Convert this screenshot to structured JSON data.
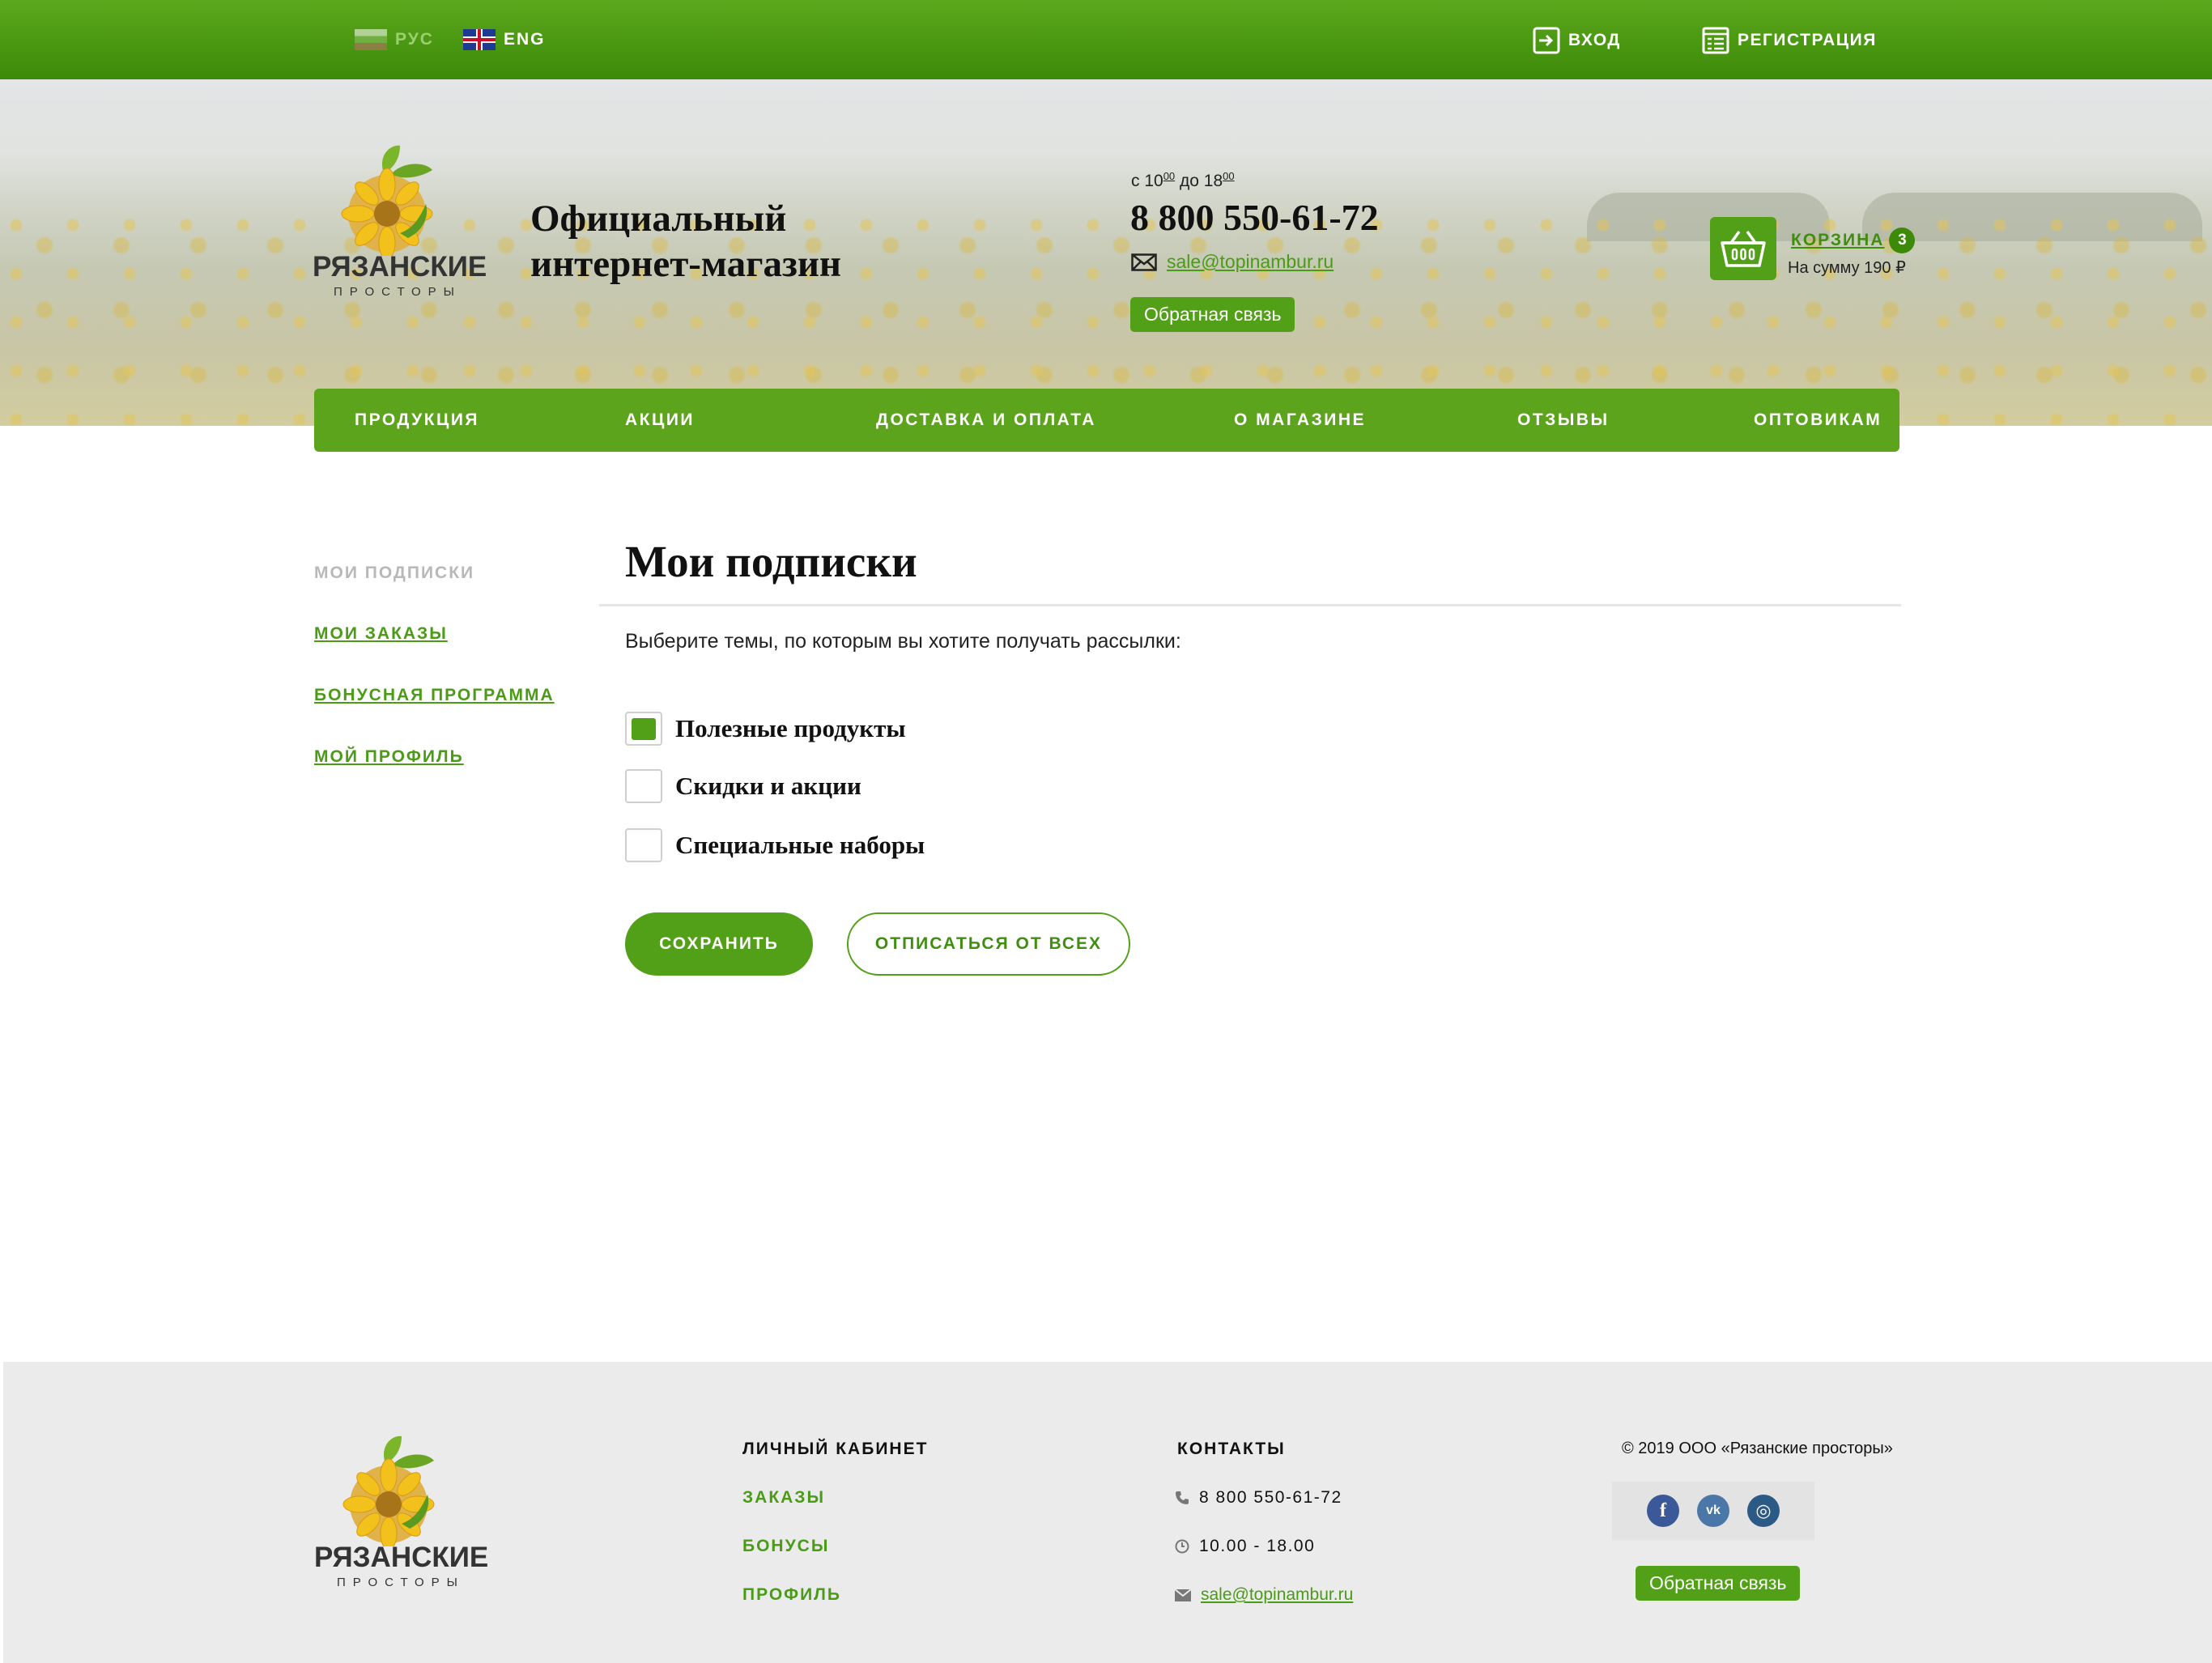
{
  "topbar": {
    "lang_ru": "РУС",
    "lang_en": "ENG",
    "login": "ВХОД",
    "register": "РЕГИСТРАЦИЯ"
  },
  "brand": {
    "name": "РЯЗАНСКИЕ",
    "sub": "ПРОСТОРЫ",
    "tagline_line1": "Официальный",
    "tagline_line2": "интернет-магазин"
  },
  "contacts": {
    "hours_from": "с 10",
    "hours_from_sup": "00",
    "hours_to": "до 18",
    "hours_to_sup": "00",
    "phone": "8 800 550-61-72",
    "email": "sale@topinambur.ru",
    "feedback": "Обратная связь"
  },
  "cart": {
    "label": "КОРЗИНА",
    "count": "3",
    "sum": "На сумму 190 ₽"
  },
  "nav": [
    "ПРОДУКЦИЯ",
    "АКЦИИ",
    "ДОСТАВКА И ОПЛАТА",
    "О МАГАЗИНЕ",
    "ОТЗЫВЫ",
    "ОПТОВИКАМ"
  ],
  "sidebar": {
    "items": [
      {
        "label": "МОИ ПОДПИСКИ",
        "active": true
      },
      {
        "label": "МОИ ЗАКАЗЫ",
        "active": false
      },
      {
        "label": "БОНУСНАЯ ПРОГРАММА",
        "active": false
      },
      {
        "label": "МОЙ ПРОФИЛЬ",
        "active": false
      }
    ]
  },
  "main": {
    "title": "Мои подписки",
    "intro": "Выберите темы, по которым вы хотите получать рассылки:",
    "options": [
      {
        "label": "Полезные продукты",
        "checked": true
      },
      {
        "label": "Скидки и акции",
        "checked": false
      },
      {
        "label": "Специальные наборы",
        "checked": false
      }
    ],
    "save": "СОХРАНИТЬ",
    "unsubscribe": "ОТПИСАТЬСЯ ОТ ВСЕХ"
  },
  "footer": {
    "cabinet_title": "ЛИЧНЫЙ КАБИНЕТ",
    "cabinet_links": [
      "ЗАКАЗЫ",
      "БОНУСЫ",
      "ПРОФИЛЬ"
    ],
    "contacts_title": "КОНТАКТЫ",
    "phone": "8 800 550-61-72",
    "hours": "10.00 - 18.00",
    "email": "sale@topinambur.ru",
    "copyright": "© 2019 ООО «Рязанские просторы»",
    "feedback": "Обратная связь",
    "social": [
      {
        "icon": "facebook-icon",
        "glyph": "f",
        "color": "#3b5998"
      },
      {
        "icon": "vk-icon",
        "glyph": "vk",
        "color": "#4a76a8"
      },
      {
        "icon": "instagram-icon",
        "glyph": "◎",
        "color": "#2b5a86"
      }
    ]
  },
  "colors": {
    "brand_green": "#52a018",
    "topbar_green": "#3c8a08",
    "link_green": "#4a9b16"
  }
}
